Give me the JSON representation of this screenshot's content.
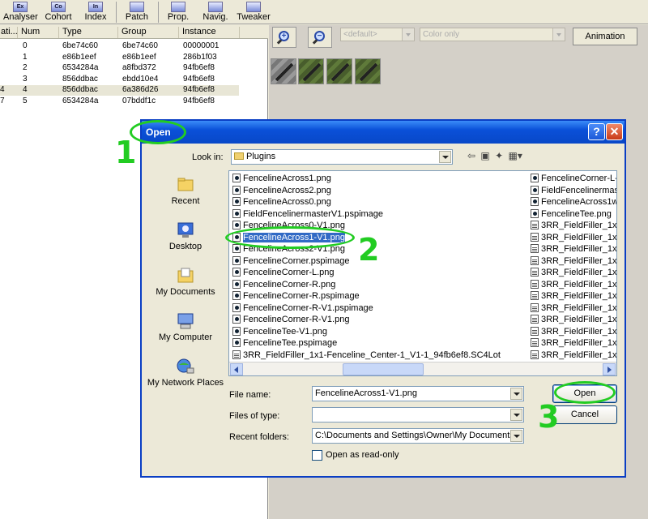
{
  "toolbar": {
    "buttons": [
      {
        "label": "Analyser",
        "icon": "Ex"
      },
      {
        "label": "Cohort",
        "icon": "Co"
      },
      {
        "label": "Index",
        "icon": "In"
      },
      {
        "label": "Patch",
        "icon": ""
      },
      {
        "label": "Prop.",
        "icon": ""
      },
      {
        "label": "Navig.",
        "icon": ""
      },
      {
        "label": "Tweaker",
        "icon": ""
      }
    ]
  },
  "listview": {
    "columns": [
      "ati...",
      "Num",
      "Type",
      "Group",
      "Instance"
    ],
    "rows": [
      {
        "ati": "",
        "num": "0",
        "type": "6be74c60",
        "group": "6be74c60",
        "instance": "00000001"
      },
      {
        "ati": "",
        "num": "1",
        "type": "e86b1eef",
        "group": "e86b1eef",
        "instance": "286b1f03"
      },
      {
        "ati": "",
        "num": "2",
        "type": "6534284a",
        "group": "a8fbd372",
        "instance": "94fb6ef8"
      },
      {
        "ati": "",
        "num": "3",
        "type": "856ddbac",
        "group": "ebdd10e4",
        "instance": "94fb6ef8"
      },
      {
        "ati": "4",
        "num": "4",
        "type": "856ddbac",
        "group": "6a386d26",
        "instance": "94fb6ef8"
      },
      {
        "ati": "7",
        "num": "5",
        "type": "6534284a",
        "group": "07bddf1c",
        "instance": "94fb6ef8"
      }
    ]
  },
  "preview": {
    "zoom_in_symbol": "+",
    "zoom_out_symbol": "−",
    "texture_combo": "<default>",
    "color_combo": "Color only",
    "animation_label": "Animation"
  },
  "dialog": {
    "title": "Open",
    "help_symbol": "?",
    "close_symbol": "✕",
    "look_in_label": "Look in:",
    "look_in_value": "Plugins",
    "places": [
      "Recent",
      "Desktop",
      "My Documents",
      "My Computer",
      "My Network Places"
    ],
    "files_col1": [
      {
        "name": "FencelineAcross1.png",
        "type": "png"
      },
      {
        "name": "FencelineAcross2.png",
        "type": "png"
      },
      {
        "name": "FencelineAcross0.png",
        "type": "png"
      },
      {
        "name": "FieldFencelinermasterV1.pspimage",
        "type": "png"
      },
      {
        "name": "FencelineAcross0-V1.png",
        "type": "png"
      },
      {
        "name": "FencelineAcross1-V1.png",
        "type": "png",
        "selected": true
      },
      {
        "name": "FencelineAcross2-V1.png",
        "type": "png"
      },
      {
        "name": "FencelineCorner.pspimage",
        "type": "png"
      },
      {
        "name": "FencelineCorner-L.png",
        "type": "png"
      },
      {
        "name": "FencelineCorner-R.png",
        "type": "png"
      },
      {
        "name": "FencelineCorner-R.pspimage",
        "type": "png"
      },
      {
        "name": "FencelineCorner-R-V1.pspimage",
        "type": "png"
      },
      {
        "name": "FencelineCorner-R-V1.png",
        "type": "png"
      },
      {
        "name": "FencelineTee-V1.png",
        "type": "png"
      },
      {
        "name": "FencelineTee.pspimage",
        "type": "png"
      },
      {
        "name": "3RR_FieldFiller_1x1-Fenceline_Center-1_V1-1_94fb6ef8.SC4Lot",
        "type": "doc"
      }
    ],
    "files_col2": [
      {
        "name": "FencelineCorner-L-",
        "type": "png"
      },
      {
        "name": "FieldFencelinermast",
        "type": "png"
      },
      {
        "name": "FencelineAcross1w",
        "type": "png"
      },
      {
        "name": "FencelineTee.png",
        "type": "png"
      },
      {
        "name": "3RR_FieldFiller_1x1",
        "type": "doc"
      },
      {
        "name": "3RR_FieldFiller_1x1",
        "type": "doc"
      },
      {
        "name": "3RR_FieldFiller_1x1",
        "type": "doc"
      },
      {
        "name": "3RR_FieldFiller_1x1",
        "type": "doc"
      },
      {
        "name": "3RR_FieldFiller_1x1",
        "type": "doc"
      },
      {
        "name": "3RR_FieldFiller_1x1",
        "type": "doc"
      },
      {
        "name": "3RR_FieldFiller_1x1",
        "type": "doc"
      },
      {
        "name": "3RR_FieldFiller_1x1",
        "type": "doc"
      },
      {
        "name": "3RR_FieldFiller_1x1",
        "type": "doc"
      },
      {
        "name": "3RR_FieldFiller_1x1",
        "type": "doc"
      },
      {
        "name": "3RR_FieldFiller_1x1",
        "type": "doc"
      },
      {
        "name": "3RR_FieldFiller_1x1",
        "type": "doc"
      }
    ],
    "file_name_label": "File name:",
    "file_name_value": "FencelineAcross1-V1.png",
    "files_of_type_label": "Files of type:",
    "files_of_type_value": "",
    "recent_folders_label": "Recent folders:",
    "recent_folders_value": "C:\\Documents and Settings\\Owner\\My Documents",
    "read_only_label": "Open as read-only",
    "open_label": "Open",
    "cancel_label": "Cancel"
  },
  "annotations": {
    "step1": "1",
    "step2": "2",
    "step3": "3",
    "color": "#22cc22"
  }
}
